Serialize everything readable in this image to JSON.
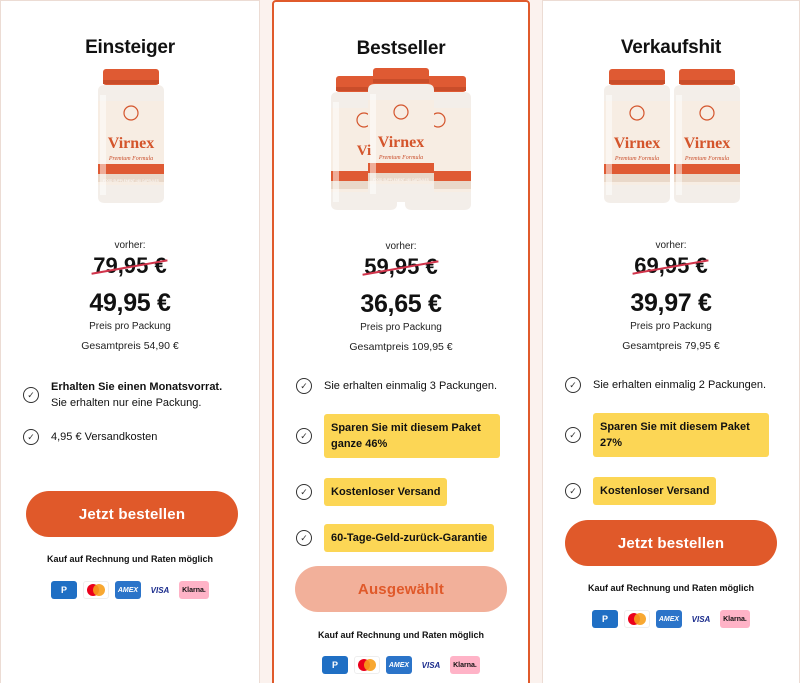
{
  "cards": [
    {
      "title": "Einsteiger",
      "vorher_label": "vorher:",
      "old_price": "79,95 €",
      "new_price": "49,95 €",
      "per_pack": "Preis pro Packung",
      "total": "Gesamtpreis 54,90 €",
      "features": [
        {
          "bold": "Erhalten Sie einen Monatsvorrat.",
          "text": "Sie erhalten nur eine Packung."
        },
        {
          "text": "4,95 € Versandkosten"
        }
      ],
      "button": "Jetzt bestellen",
      "rechnung": "Kauf auf Rechnung und Raten möglich"
    },
    {
      "title": "Bestseller",
      "vorher_label": "vorher:",
      "old_price": "59,95 €",
      "new_price": "36,65 €",
      "per_pack": "Preis pro Packung",
      "total": "Gesamtpreis 109,95 €",
      "features": [
        {
          "text": "Sie erhalten einmalig 3 Packungen."
        },
        {
          "highlight": "Sparen Sie mit diesem Paket ganze 46%"
        },
        {
          "highlight": "Kostenloser Versand"
        },
        {
          "highlight": "60-Tage-Geld-zurück-Garantie"
        }
      ],
      "button": "Ausgewählt",
      "rechnung": "Kauf auf Rechnung und Raten möglich"
    },
    {
      "title": "Verkaufshit",
      "vorher_label": "vorher:",
      "old_price": "69,95 €",
      "new_price": "39,97 €",
      "per_pack": "Preis pro Packung",
      "total": "Gesamtpreis 79,95 €",
      "features": [
        {
          "text": "Sie erhalten einmalig 2 Packungen."
        },
        {
          "highlight": "Sparen Sie mit diesem Paket 27%"
        },
        {
          "highlight": "Kostenloser Versand"
        }
      ],
      "button": "Jetzt bestellen",
      "rechnung": "Kauf auf Rechnung und Raten möglich"
    }
  ],
  "product": {
    "brand": "Virnex",
    "subtitle": "Premium Formula",
    "band": "FOOD SUPPLEMENT | 60 CAPSULES"
  },
  "payment_methods": [
    "P",
    "mastercard",
    "AMEX",
    "VISA",
    "Klarna."
  ],
  "colors": {
    "accent": "#e0592a",
    "highlight": "#fcd655",
    "strike": "#d1344b",
    "selected_button": "#f2b09a"
  }
}
